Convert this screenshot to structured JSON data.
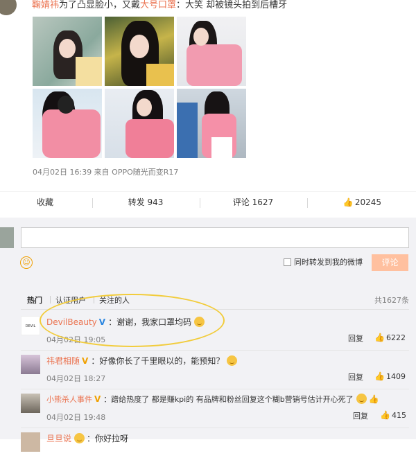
{
  "post": {
    "author": "鞠婧祎",
    "text_1": "为了凸显脸小，又戴",
    "keyword": "大号口罩",
    "text_2": "：大笑 却被镜头拍到后槽牙",
    "meta": "04月02日 16:39  来自 OPPO随光而变R17",
    "images": [
      "photo-1",
      "photo-2",
      "photo-3",
      "photo-4",
      "photo-5",
      "photo-6"
    ]
  },
  "actions": {
    "favorite": "收藏",
    "repost": "转发 943",
    "comment": "评论 1627",
    "like": "20245"
  },
  "composer": {
    "repost_checkbox_label": "同时转发到我的微博",
    "submit_label": "评论"
  },
  "filters": {
    "hot": "热门",
    "verified": "认证用户",
    "following": "关注的人",
    "total": "共1627条"
  },
  "comments": [
    {
      "name": "DevilBeauty",
      "badge": "V",
      "text": "：谢谢，我家口罩均码",
      "time": "04月02日 19:05",
      "reply": "回复",
      "likes": "6222",
      "badge_color": "#2b86e0"
    },
    {
      "name": "祎君相随",
      "badge": "V",
      "text": "：好像你长了千里眼以的，能预知？",
      "time": "04月02日 18:27",
      "reply": "回复",
      "likes": "1409",
      "badge_color": "#f0a000"
    },
    {
      "name": "小熊杀人事件",
      "badge": "V",
      "text": "：蹭给热度了 都是赚kpi的 有品牌和粉丝回复这个糊b营销号估计开心死了",
      "time": "04月02日 19:48",
      "reply": "回复",
      "likes": "415",
      "badge_color": "#f0a000"
    },
    {
      "name": "旦旦说",
      "text": "：你好拉呀"
    }
  ],
  "colors": {
    "accent": "#eb7350",
    "highlight_ellipse": "#f2cc3b",
    "submit_bg": "#ffc09f"
  }
}
